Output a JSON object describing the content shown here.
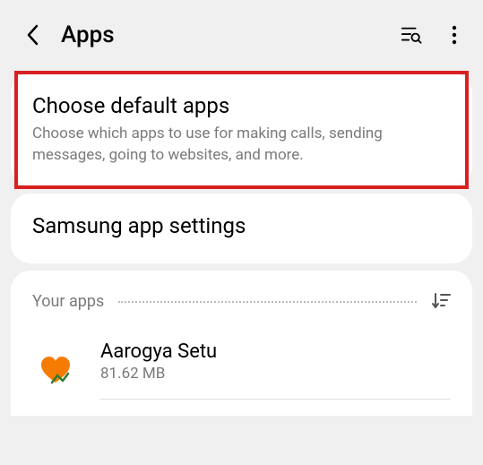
{
  "header": {
    "title": "Apps"
  },
  "cards": {
    "defaultApps": {
      "title": "Choose default apps",
      "subtitle": "Choose which apps to use for making calls, sending messages, going to websites, and more."
    },
    "samsungSettings": {
      "title": "Samsung app settings"
    }
  },
  "yourApps": {
    "heading": "Your apps",
    "apps": [
      {
        "name": "Aarogya Setu",
        "size": "81.62 MB"
      }
    ]
  }
}
